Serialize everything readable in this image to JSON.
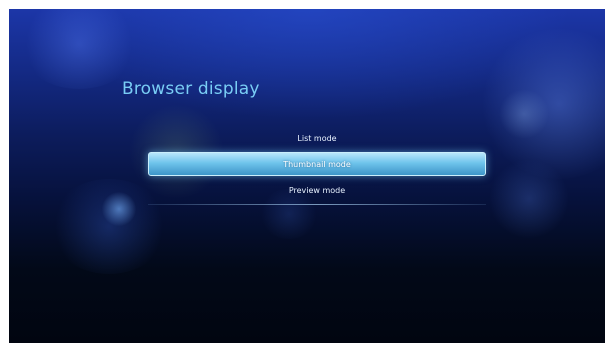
{
  "screen": {
    "title": "Browser display"
  },
  "menu": {
    "items": [
      {
        "label": "List mode",
        "selected": false
      },
      {
        "label": "Thumbnail mode",
        "selected": true
      },
      {
        "label": "Preview mode",
        "selected": false
      }
    ]
  },
  "colors": {
    "title_text": "#79cdf5",
    "highlight": "#6fc4ec",
    "background_top": "#1c36a8",
    "background_bottom": "#010510"
  }
}
